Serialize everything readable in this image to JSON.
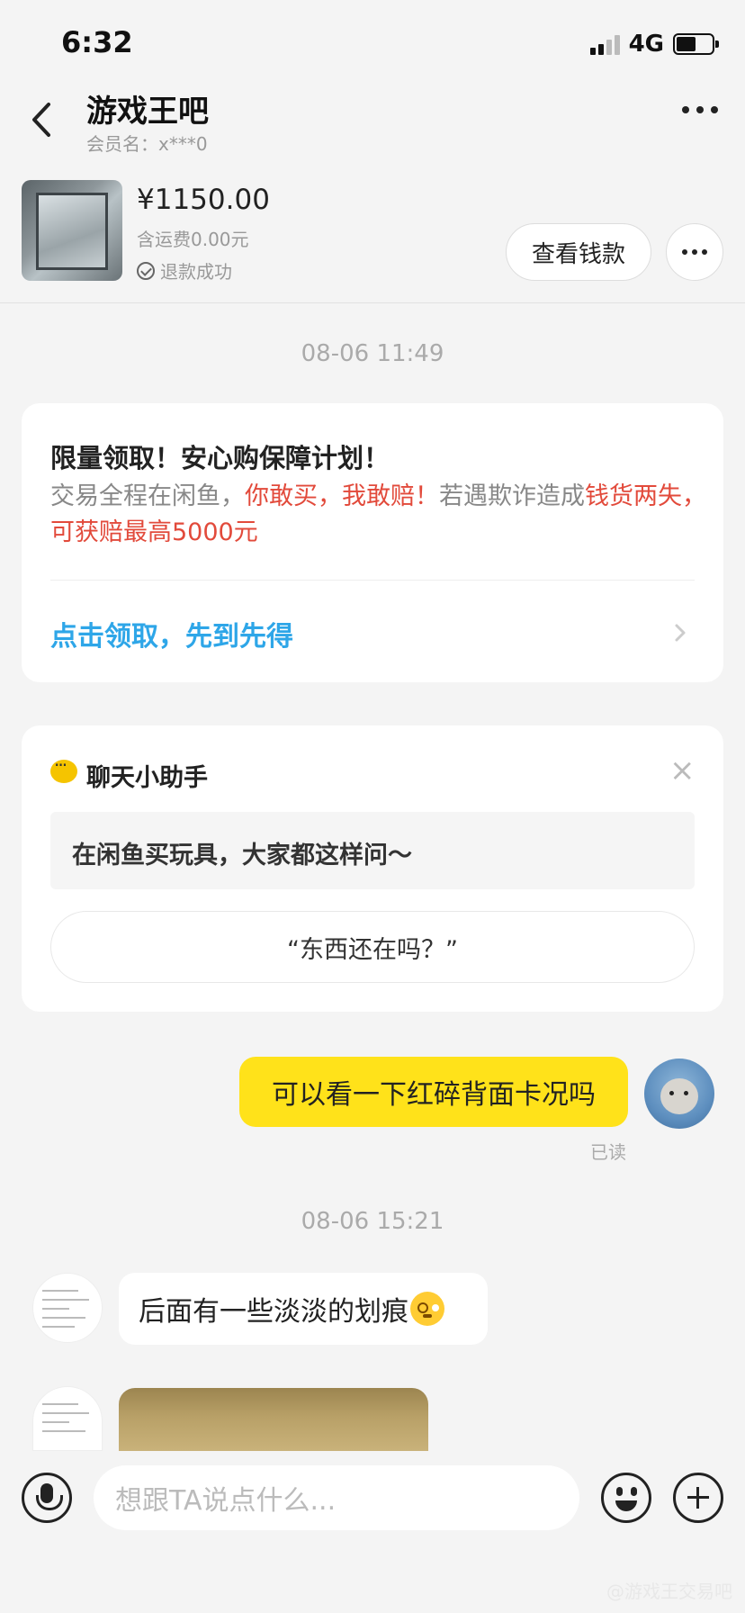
{
  "status_bar": {
    "time": "6:32",
    "network": "4G"
  },
  "header": {
    "title": "游戏王吧",
    "subtitle": "会员名：x***0"
  },
  "product": {
    "price": "¥1150.00",
    "shipping": "含运费0.00元",
    "status": "退款成功",
    "view_money_label": "查看钱款"
  },
  "timestamps": [
    "08-06 11:49",
    "08-06 15:21"
  ],
  "promo": {
    "title": "限量领取！安心购保障计划！",
    "body_1": "交易全程在闲鱼，",
    "body_red_1": "你敢买，我敢赔！",
    "body_2": "若遇欺诈造成",
    "body_red_2": "钱货两失，可获赔最高5000元",
    "link": "点击领取，先到先得"
  },
  "assistant": {
    "title": "聊天小助手",
    "question": "在闲鱼买玩具，大家都这样问～",
    "suggestion": "“东西还在吗？”"
  },
  "messages": {
    "mine": "可以看一下红碎背面卡况吗",
    "read_status": "已读",
    "reply": "后面有一些淡淡的划痕"
  },
  "input": {
    "placeholder": "想跟TA说点什么..."
  },
  "watermark": "@游戏王交易吧",
  "colors": {
    "accent_yellow": "#ffe21a",
    "link_blue": "#2ea6e8",
    "warn_red": "#e24a3b"
  }
}
